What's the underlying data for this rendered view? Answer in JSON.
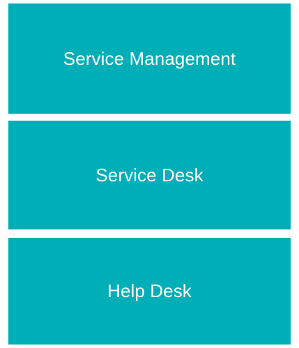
{
  "colors": {
    "box_fill": "#00aeb8",
    "text": "#ffffff",
    "background": "#ffffff"
  },
  "boxes": [
    {
      "label": "Service Management"
    },
    {
      "label": "Service Desk"
    },
    {
      "label": "Help Desk"
    }
  ]
}
